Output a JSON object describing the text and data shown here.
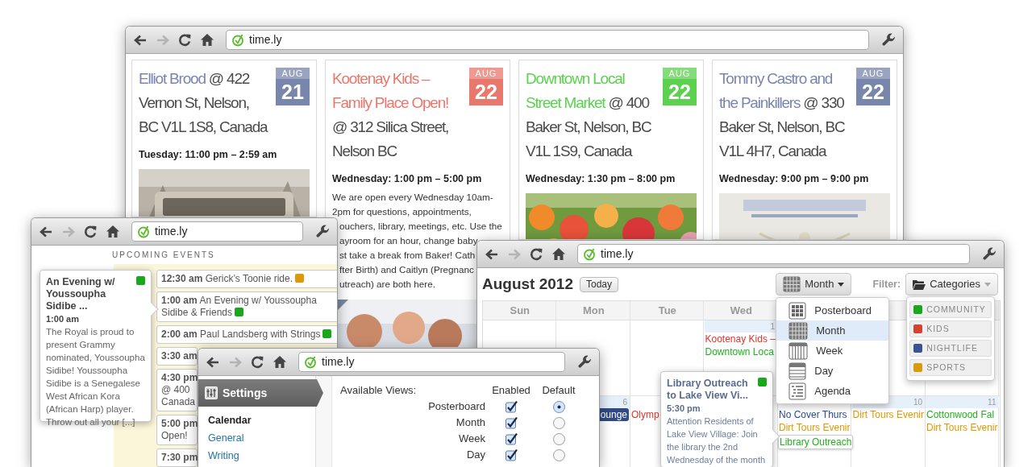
{
  "poster_window": {
    "url": "time.ly",
    "forward_disabled": true,
    "cards": [
      {
        "title": "Elliot Brood",
        "location": "@ 422 Vernon St, Nelson, BC V1L 1S8, Canada",
        "month": "AUG",
        "day": "21",
        "color": "#7886ac",
        "time": "Tuesday: 11:00 pm – 2:59 am"
      },
      {
        "title": "Kootenay Kids – Family Place Open!",
        "location": "@ 312 Silica Street, Nelson BC",
        "month": "AUG",
        "day": "22",
        "color": "#e8776c",
        "time": "Wednesday: 1:00 pm – 5:00 pm",
        "description_lines": [
          {
            "kind": "full",
            "text": "We are open every Wednesday 10am-"
          },
          {
            "kind": "full",
            "text": "2pm for questions, appointments,"
          },
          {
            "kind": "cut",
            "text": "ouchers, library, meetings, etc. Use the"
          },
          {
            "kind": "cut",
            "text": "ayroom for an hour, change baby"
          },
          {
            "kind": "cut",
            "text": "st take a break from Baker! Cath"
          },
          {
            "kind": "cut",
            "text": "fter Birth) and Caitlyn (Pregnanc"
          },
          {
            "kind": "cut",
            "text": "utreach) are both here."
          }
        ]
      },
      {
        "title": "Downtown Local Street Market",
        "location": "@ 400 Baker St, Nelson, BC V1L 1S9, Canada",
        "month": "AUG",
        "day": "22",
        "color": "#5bd14f",
        "time": "Wednesday: 1:30 pm – 8:00 pm"
      },
      {
        "title": "Tommy Castro and the Painkillers",
        "location": "@ 330 Baker St, Nelson, BC V1L 4H7, Canada",
        "month": "AUG",
        "day": "22",
        "color": "#7886ac",
        "time": "Wednesday: 9:00 pm – 9:00 pm"
      }
    ]
  },
  "upcoming_window": {
    "url": "time.ly",
    "forward_disabled": true,
    "heading": "UPCOMING EVENTS",
    "events": [
      {
        "time": "12:30 am",
        "title": "Gerick’s Toonie ride.",
        "color": "#db9a0c"
      },
      {
        "time": "1:00 am",
        "title": "An Evening w/ Youssoupha Sidibe & Friends",
        "color": "#19a81b"
      },
      {
        "time": "2:00 am",
        "title": "Paul Landsberg with Strings",
        "color": "#19a81b"
      },
      {
        "time": "3:30 am"
      },
      {
        "time": "4:30 pm",
        "lines": [
          "@ 400",
          "Canada"
        ]
      },
      {
        "time": "5:00 pm",
        "lines": [
          "Open!"
        ]
      },
      {
        "time": "7:30 pm"
      }
    ],
    "popover": {
      "title": "An Evening w/ Youssoupha Sidibe ...",
      "color": "#19a81b",
      "time": "1:00 am",
      "description": "The Royal is proud to present Grammy nominated, Youssoupha Sidibe! Youssoupha Sidibe is a Senegalese West African Kora (African Harp) player. Throw out all your [...]"
    }
  },
  "calendar_window": {
    "url": "time.ly",
    "forward_disabled": true,
    "title": "August 2012",
    "today_button": "Today",
    "view_button": "Month",
    "filter_label": "Filter:",
    "categories_button": "Categories",
    "view_menu": [
      {
        "label": "Posterboard",
        "selected": false
      },
      {
        "label": "Month",
        "selected": true
      },
      {
        "label": "Week",
        "selected": false
      },
      {
        "label": "Day",
        "selected": false
      },
      {
        "label": "Agenda",
        "selected": false
      }
    ],
    "categories": [
      {
        "label": "COMMUNITY",
        "color": "#19a81b"
      },
      {
        "label": "KIDS",
        "color": "#d8412f"
      },
      {
        "label": "NIGHTLIFE",
        "color": "#3a5493"
      },
      {
        "label": "SPORTS",
        "color": "#db9a0c"
      }
    ],
    "weekdays": [
      "Sun",
      "Mon",
      "Tue",
      "Wed"
    ],
    "weeks": [
      {
        "wed": {
          "day": "1",
          "events": [
            {
              "kind": "text",
              "text": "Kootenay Kids –",
              "color": "#e0352c"
            },
            {
              "kind": "text",
              "text": "Downtown Loca",
              "color": "#22b01f"
            }
          ]
        }
      },
      {
        "mon": {
          "day": "6",
          "events": [
            {
              "kind": "badge",
              "text": "ounge",
              "color": "#2f4a86"
            }
          ]
        },
        "tue": {
          "events": [
            {
              "kind": "text",
              "text": "Olymp",
              "color": "#e0352c"
            }
          ]
        },
        "thu": {
          "events": [
            {
              "kind": "text",
              "text": "No Cover Thurs",
              "color": "#2c4a8c"
            },
            {
              "kind": "text",
              "text": "Dirt Tours Evenir",
              "color": "#e09a00"
            },
            {
              "kind": "highlighted",
              "text": "Library Outreach",
              "color": "#22b01f"
            }
          ]
        },
        "fri": {
          "day": "10",
          "events": [
            {
              "kind": "text",
              "text": "Dirt Tours Evenir",
              "color": "#e09a00"
            }
          ]
        },
        "sat": {
          "day": "11",
          "events": [
            {
              "kind": "text",
              "text": "Cottonwood Fal",
              "color": "#22b01f"
            },
            {
              "kind": "text",
              "text": "Dirt Tours Evenir",
              "color": "#e09a00"
            }
          ]
        }
      }
    ],
    "popover": {
      "title": "Library Outreach to Lake View Vi...",
      "color": "#19a81b",
      "time": "5:30 pm",
      "description": "Attention Residents of Lake View Village: Join the library the 2nd Wednesday of the month"
    }
  },
  "settings_window": {
    "url": "time.ly",
    "forward_disabled": true,
    "section": "Settings",
    "nav": [
      {
        "label": "Calendar",
        "selected": true
      },
      {
        "label": "General",
        "selected": false
      },
      {
        "label": "Writing",
        "selected": false
      }
    ],
    "views_label": "Available Views:",
    "columns": [
      "Enabled",
      "Default"
    ],
    "views": [
      {
        "label": "Posterboard",
        "enabled": true,
        "default": true
      },
      {
        "label": "Month",
        "enabled": true,
        "default": false
      },
      {
        "label": "Week",
        "enabled": true,
        "default": false
      },
      {
        "label": "Day",
        "enabled": true,
        "default": false
      }
    ]
  }
}
